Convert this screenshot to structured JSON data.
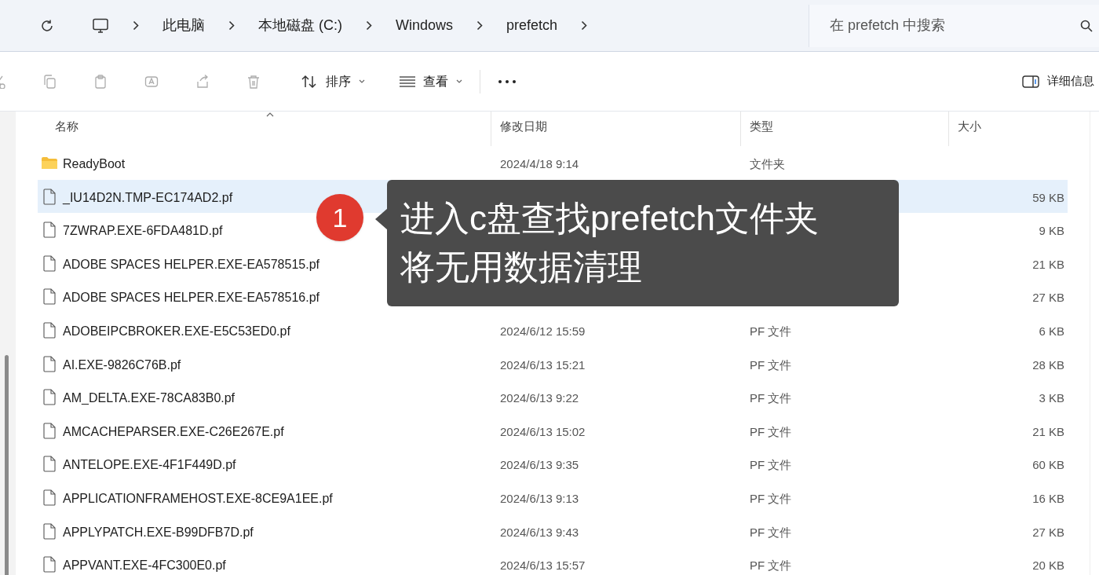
{
  "address_bar": {
    "crumbs": [
      "此电脑",
      "本地磁盘 (C:)",
      "Windows",
      "prefetch"
    ]
  },
  "search": {
    "placeholder": "在 prefetch 中搜索"
  },
  "toolbar": {
    "actions": [
      {
        "kind": "cut",
        "disabled": true
      },
      {
        "kind": "copy",
        "disabled": true
      },
      {
        "kind": "paste",
        "disabled": true
      },
      {
        "kind": "rename",
        "disabled": true
      },
      {
        "kind": "share",
        "disabled": true
      },
      {
        "kind": "delete",
        "disabled": true
      }
    ],
    "sort_label": "排序",
    "view_label": "查看",
    "details_label": "详细信息"
  },
  "columns": [
    "名称",
    "修改日期",
    "类型",
    "大小"
  ],
  "rows": [
    {
      "kind": "folder",
      "name": "ReadyBoot",
      "date": "2024/4/18 9:14",
      "type": "文件夹",
      "size": "",
      "selected": false
    },
    {
      "kind": "file",
      "name": "_IU14D2N.TMP-EC174AD2.pf",
      "size": "59 KB",
      "selected": true
    },
    {
      "kind": "file",
      "name": "7ZWRAP.EXE-6FDA481D.pf",
      "size": "9 KB",
      "selected": false
    },
    {
      "kind": "file",
      "name": "ADOBE SPACES HELPER.EXE-EA578515.pf",
      "size": "21 KB",
      "selected": false
    },
    {
      "kind": "file",
      "name": "ADOBE SPACES HELPER.EXE-EA578516.pf",
      "size": "27 KB",
      "selected": false
    },
    {
      "kind": "file",
      "name": "ADOBEIPCBROKER.EXE-E5C53ED0.pf",
      "date": "2024/6/12 15:59",
      "type": "PF 文件",
      "size": "6 KB",
      "selected": false
    },
    {
      "kind": "file",
      "name": "AI.EXE-9826C76B.pf",
      "date": "2024/6/13 15:21",
      "type": "PF 文件",
      "size": "28 KB",
      "selected": false
    },
    {
      "kind": "file",
      "name": "AM_DELTA.EXE-78CA83B0.pf",
      "date": "2024/6/13 9:22",
      "type": "PF 文件",
      "size": "3 KB",
      "selected": false
    },
    {
      "kind": "file",
      "name": "AMCACHEPARSER.EXE-C26E267E.pf",
      "date": "2024/6/13 15:02",
      "type": "PF 文件",
      "size": "21 KB",
      "selected": false
    },
    {
      "kind": "file",
      "name": "ANTELOPE.EXE-4F1F449D.pf",
      "date": "2024/6/13 9:35",
      "type": "PF 文件",
      "size": "60 KB",
      "selected": false
    },
    {
      "kind": "file",
      "name": "APPLICATIONFRAMEHOST.EXE-8CE9A1EE.pf",
      "date": "2024/6/13 9:13",
      "type": "PF 文件",
      "size": "16 KB",
      "selected": false
    },
    {
      "kind": "file",
      "name": "APPLYPATCH.EXE-B99DFB7D.pf",
      "date": "2024/6/13 9:43",
      "type": "PF 文件",
      "size": "27 KB",
      "selected": false
    },
    {
      "kind": "file",
      "name": "APPVANT.EXE-4FC300E0.pf",
      "date": "2024/6/13 15:57",
      "type": "PF 文件",
      "size": "20 KB",
      "selected": false
    }
  ],
  "callout": {
    "badge": "1",
    "lines": [
      "进入c盘查找prefetch文件夹",
      "将无用数据清理"
    ]
  }
}
